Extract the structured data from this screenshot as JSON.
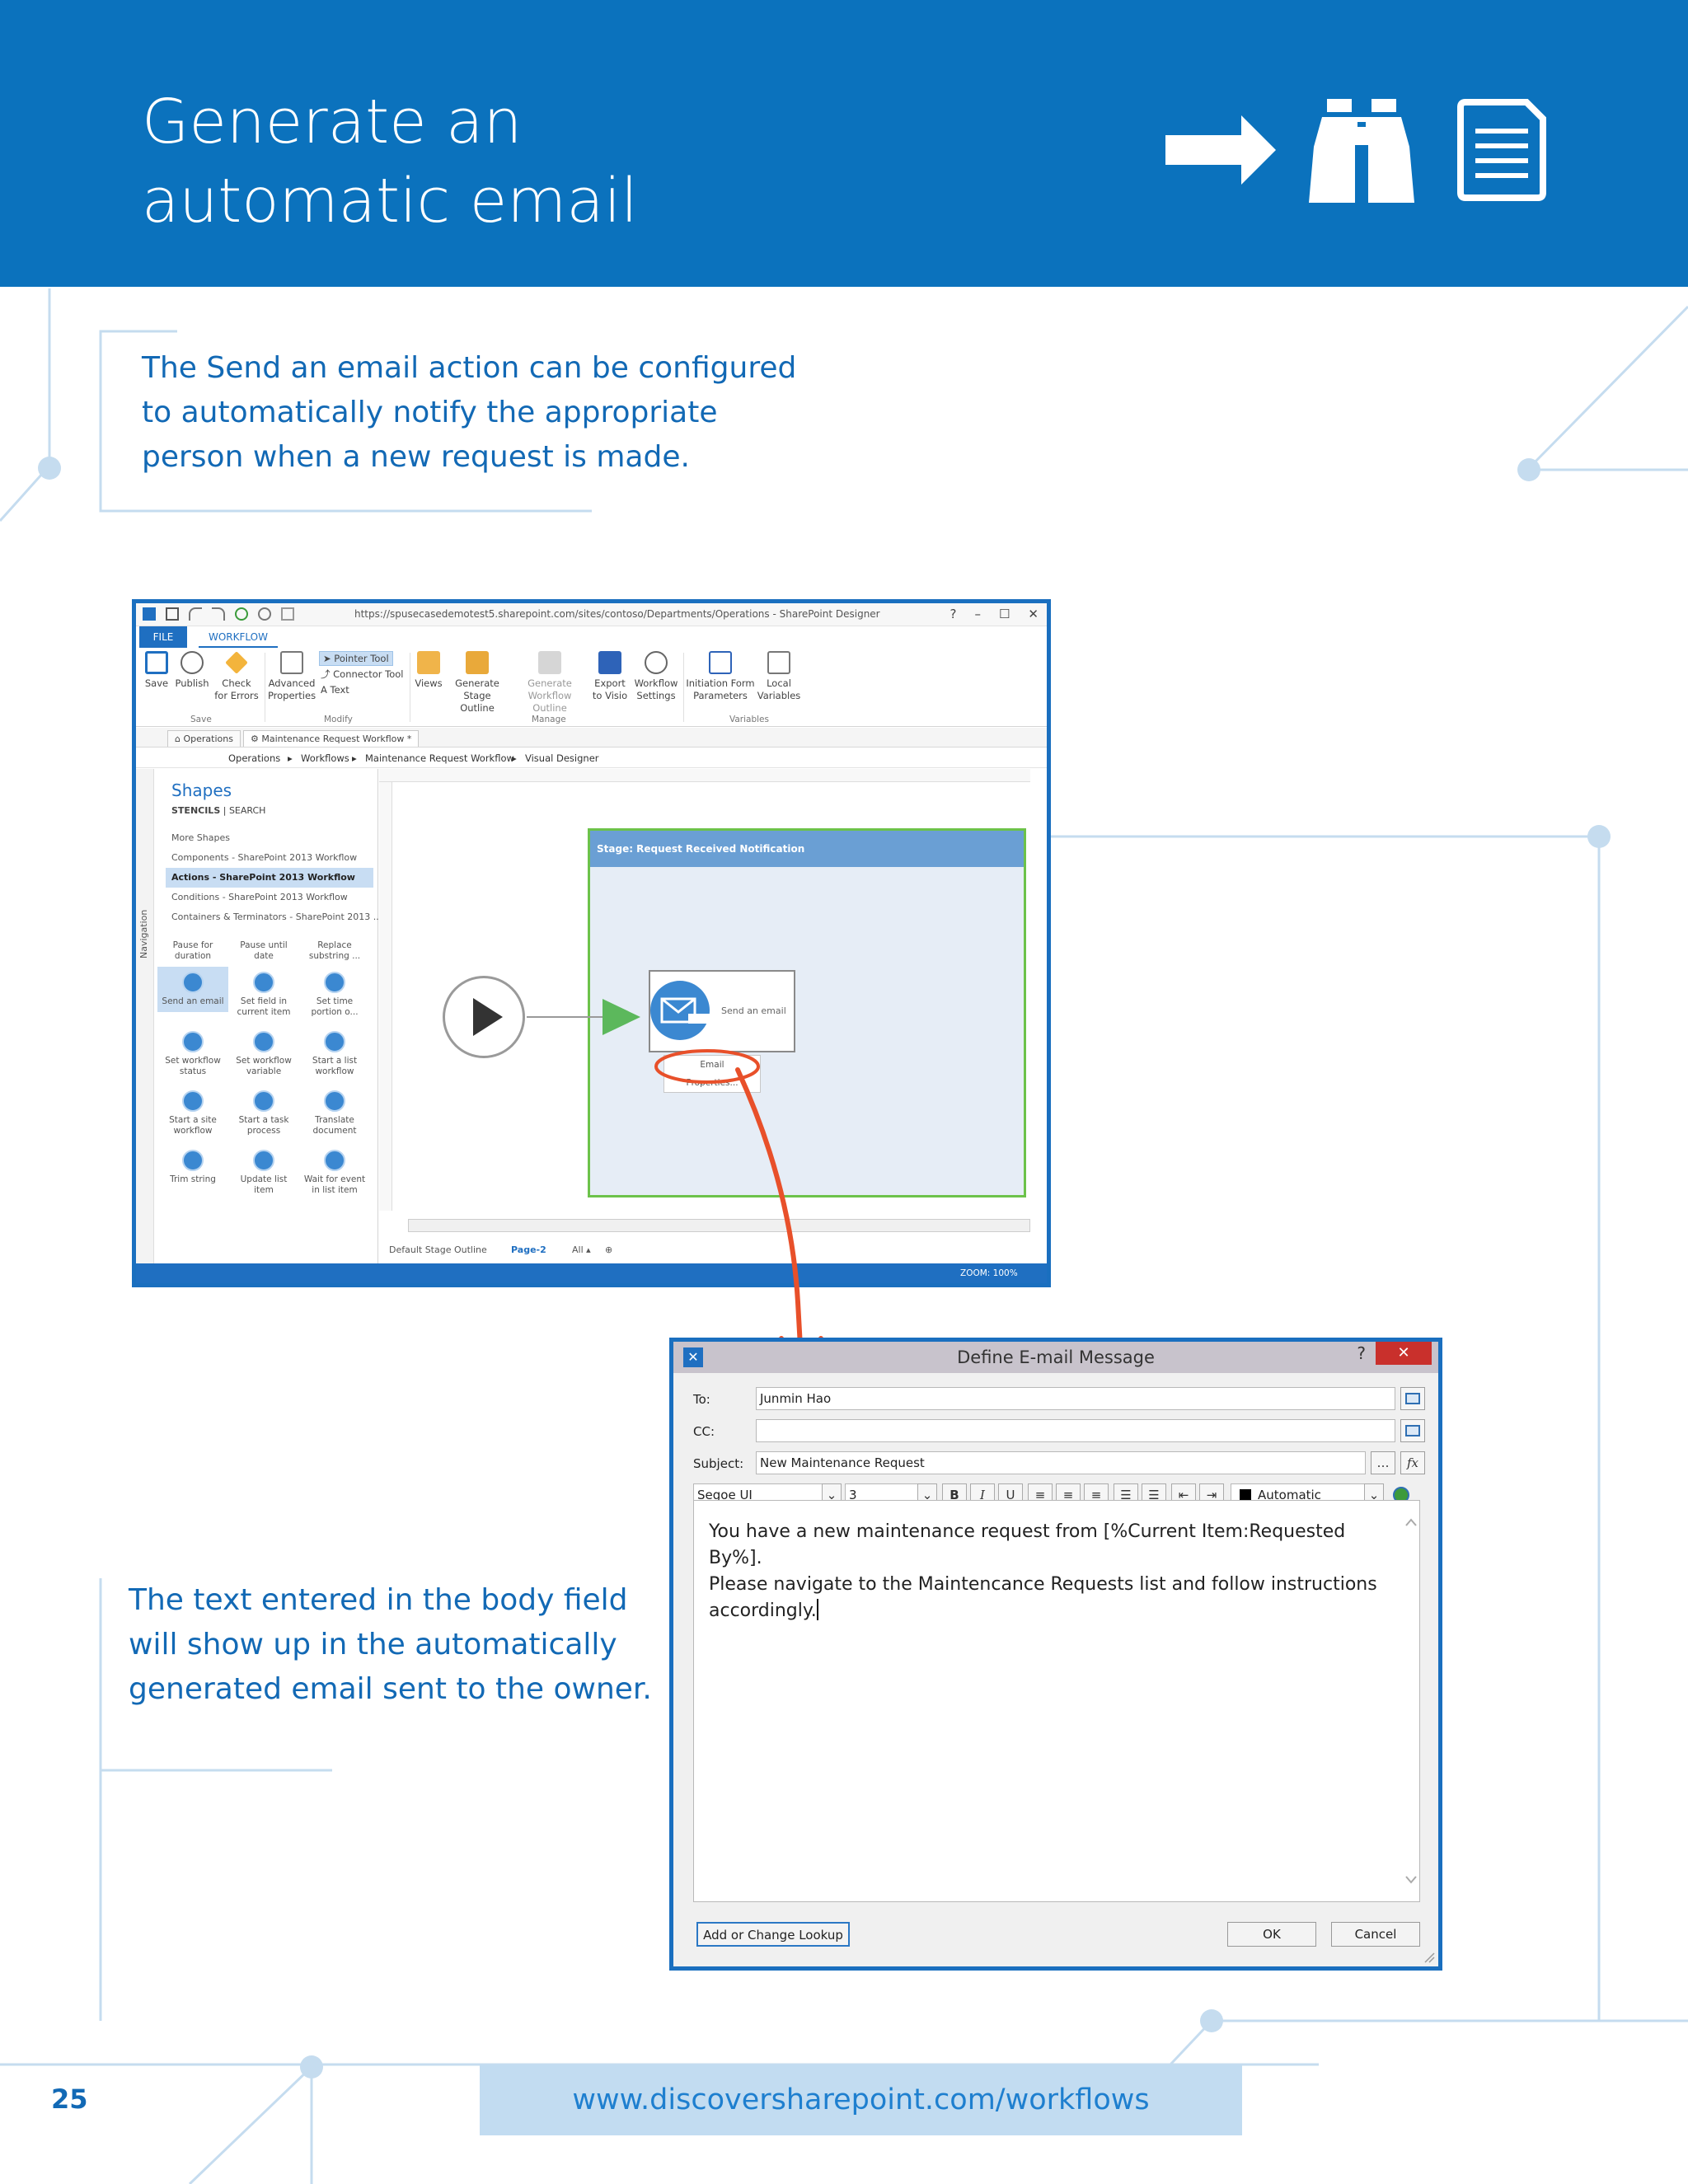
{
  "header": {
    "title_line1": "Generate an",
    "title_line2": "automatic email",
    "icons": [
      "arrow-right-icon",
      "binoculars-icon",
      "document-icon"
    ]
  },
  "callouts": {
    "top": [
      "The Send an email action can be configured",
      "to automatically notify the appropriate",
      "person when a new request is made."
    ],
    "bottom": [
      "The text entered in the body field",
      "will show up in the automatically",
      "generated email sent to the owner."
    ]
  },
  "spd": {
    "url": "https://spusecasedemotest5.sharepoint.com/sites/contoso/Departments/Operations - SharePoint Designer",
    "window_buttons": [
      "?",
      "–",
      "☐",
      "✕"
    ],
    "tabs": {
      "file": "FILE",
      "workflow": "WORKFLOW"
    },
    "ribbon": {
      "save": "Save",
      "publish": "Publish",
      "check": [
        "Check",
        "for Errors"
      ],
      "advanced": [
        "Advanced",
        "Properties"
      ],
      "pointer": "Pointer Tool",
      "connector": "Connector Tool",
      "text": "Text",
      "views": "Views",
      "generate_stage": [
        "Generate",
        "Stage Outline"
      ],
      "generate_wf": [
        "Generate",
        "Workflow Outline"
      ],
      "export": [
        "Export",
        "to Visio"
      ],
      "wf_settings": [
        "Workflow",
        "Settings"
      ],
      "init_form": [
        "Initiation Form",
        "Parameters"
      ],
      "local_vars": [
        "Local",
        "Variables"
      ],
      "groups": {
        "save": "Save",
        "modify": "Modify",
        "manage": "Manage",
        "variables": "Variables"
      }
    },
    "doc_tabs": [
      "Operations",
      "Maintenance Request Workflow *"
    ],
    "breadcrumb": [
      "Operations",
      "Workflows",
      "Maintenance Request Workflow",
      "Visual Designer"
    ],
    "shapes": {
      "title": "Shapes",
      "stencils": "STENCILS",
      "search": "SEARCH",
      "list": [
        "More Shapes",
        "Components - SharePoint 2013 Workflow",
        "Actions - SharePoint 2013 Workflow",
        "Conditions - SharePoint 2013 Workflow",
        "Containers & Terminators - SharePoint 2013 ..."
      ],
      "items": [
        [
          "Pause for",
          "duration"
        ],
        [
          "Pause until",
          "date"
        ],
        [
          "Replace",
          "substring ..."
        ],
        [
          "Send an email",
          ""
        ],
        [
          "Set field in",
          "current item"
        ],
        [
          "Set time",
          "portion o..."
        ],
        [
          "Set workflow",
          "status"
        ],
        [
          "Set workflow",
          "variable"
        ],
        [
          "Start a list",
          "workflow"
        ],
        [
          "Start a site",
          "workflow"
        ],
        [
          "Start a task",
          "process"
        ],
        [
          "Translate",
          "document"
        ],
        [
          "Trim string",
          ""
        ],
        [
          "Update list",
          "item"
        ],
        [
          "Wait for event",
          "in list item"
        ]
      ]
    },
    "navigation_label": "Navigation",
    "stage_header": "Stage:   Request Received Notification",
    "action_label": "Send an email",
    "popup": [
      "Email",
      "Properties..."
    ],
    "page_tabs": {
      "outline": "Default Stage Outline",
      "page": "Page-2",
      "all": "All ▴"
    },
    "zoom": "ZOOM: 100%"
  },
  "dialog": {
    "title": "Define E-mail Message",
    "help": "?",
    "close": "✕",
    "to_label": "To:",
    "to_value": "Junmin Hao",
    "cc_label": "CC:",
    "cc_value": "",
    "subject_label": "Subject:",
    "subject_value": "New Maintenance Request",
    "font": "Segoe UI",
    "size": "3",
    "color": "Automatic",
    "body_lines": [
      "You have a new maintenance request from [%Current Item:Requested By%].",
      "Please navigate to the Maintencance Requests list and follow instructions",
      "accordingly."
    ],
    "lookup_button": "Add or Change Lookup",
    "ok": "OK",
    "cancel": "Cancel",
    "accent": "#c9302c"
  },
  "footer": {
    "page_number": "25",
    "url": "www.discoversharepoint.com/workflows"
  },
  "colors": {
    "header_blue": "#0b72bd",
    "callout_text": "#1269b5",
    "footer_bar": "#c2dcf1",
    "annotation_red": "#e8502a"
  }
}
